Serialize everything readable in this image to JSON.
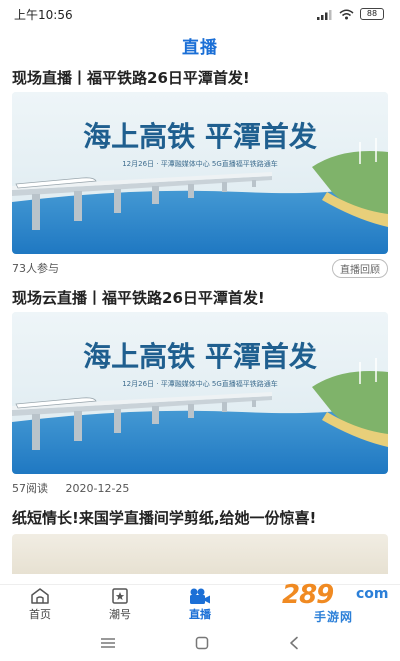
{
  "status": {
    "time": "上午10:56",
    "battery": "88",
    "icons": [
      "signal-icon",
      "wifi-icon",
      "battery-icon"
    ]
  },
  "header": {
    "title": "直播"
  },
  "feed": [
    {
      "title": "现场直播丨福平铁路26日平潭首发!",
      "banner_headline": "海上高铁 平潭首发",
      "banner_subline": "12月26日 · 平潭融媒体中心 5G直播福平铁路通车",
      "participants": "73人参与",
      "tag": "直播回顾"
    },
    {
      "title": "现场云直播丨福平铁路26日平潭首发!",
      "banner_headline": "海上高铁 平潭首发",
      "banner_subline": "12月26日 · 平潭融媒体中心 5G直播福平铁路通车",
      "reads": "57阅读",
      "date": "2020-12-25"
    },
    {
      "title": "纸短情长!来国学直播间学剪纸,给她一份惊喜!"
    }
  ],
  "tabs": [
    {
      "label": "首页",
      "icon": "home-icon"
    },
    {
      "label": "潮号",
      "icon": "star-box-icon"
    },
    {
      "label": "直播",
      "icon": "video-camera-icon",
      "active": true
    },
    {
      "label": "",
      "icon": ""
    },
    {
      "label": "",
      "icon": ""
    }
  ],
  "watermark": {
    "number": "289",
    "domain_mark": "com",
    "text": "手游网"
  },
  "colors": {
    "accent": "#1b6fd6",
    "watermark_orange": "#f08a22",
    "watermark_blue": "#2b7fd8"
  }
}
